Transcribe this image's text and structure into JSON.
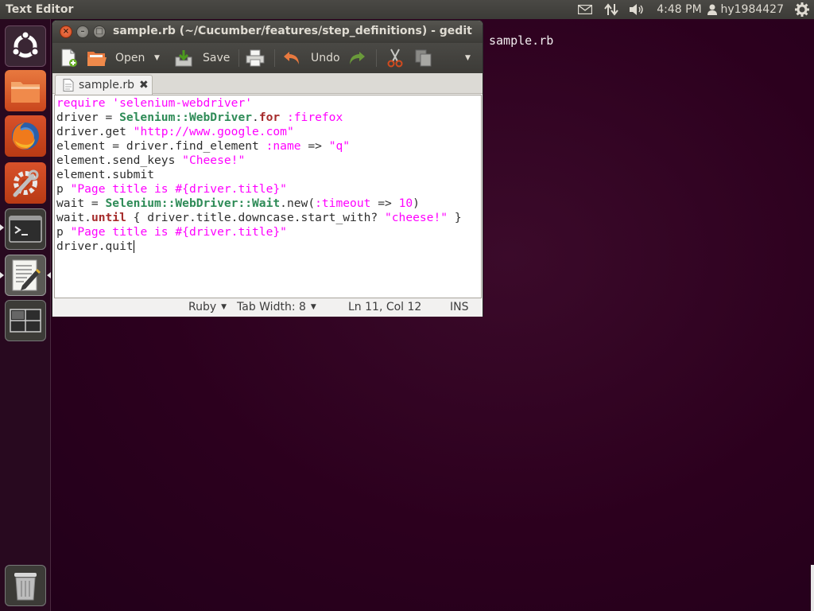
{
  "panel": {
    "app_title": "Text Editor",
    "clock": "4:48 PM",
    "user": "hy1984427",
    "icons": [
      "mail-icon",
      "network-icon",
      "volume-icon",
      "user-icon",
      "settings-gear-icon"
    ]
  },
  "launcher": {
    "items": [
      {
        "name": "ubuntu-dash-icon"
      },
      {
        "name": "files-icon"
      },
      {
        "name": "firefox-icon"
      },
      {
        "name": "system-settings-icon"
      },
      {
        "name": "terminal-icon"
      },
      {
        "name": "text-editor-icon"
      },
      {
        "name": "workspace-switcher-icon"
      },
      {
        "name": "trash-icon"
      }
    ]
  },
  "window": {
    "title": "sample.rb (~/Cucumber/features/step_definitions) - gedit"
  },
  "toolbar": {
    "open_label": "Open",
    "save_label": "Save",
    "undo_label": "Undo"
  },
  "tab": {
    "label": "sample.rb",
    "close_glyph": "✖"
  },
  "code": {
    "lines": [
      [
        {
          "t": "str",
          "v": "require 'selenium-webdriver'"
        }
      ],
      [
        {
          "t": "plain",
          "v": "driver = "
        },
        {
          "t": "const",
          "v": "Selenium::WebDriver"
        },
        {
          "t": "plain",
          "v": "."
        },
        {
          "t": "kw",
          "v": "for"
        },
        {
          "t": "plain",
          "v": " "
        },
        {
          "t": "sym",
          "v": ":firefox"
        }
      ],
      [
        {
          "t": "plain",
          "v": "driver.get "
        },
        {
          "t": "str",
          "v": "\"http://www.google.com\""
        }
      ],
      [
        {
          "t": "plain",
          "v": "element = driver.find_element "
        },
        {
          "t": "sym",
          "v": ":name"
        },
        {
          "t": "plain",
          "v": " => "
        },
        {
          "t": "str",
          "v": "\"q\""
        }
      ],
      [
        {
          "t": "plain",
          "v": "element.send_keys "
        },
        {
          "t": "str",
          "v": "\"Cheese!\""
        }
      ],
      [
        {
          "t": "plain",
          "v": "element.submit"
        }
      ],
      [
        {
          "t": "plain",
          "v": "p "
        },
        {
          "t": "str",
          "v": "\"Page title is #{driver.title}\""
        }
      ],
      [
        {
          "t": "plain",
          "v": "wait = "
        },
        {
          "t": "const",
          "v": "Selenium::WebDriver::Wait"
        },
        {
          "t": "plain",
          "v": ".new("
        },
        {
          "t": "sym",
          "v": ":timeout"
        },
        {
          "t": "plain",
          "v": " => "
        },
        {
          "t": "num",
          "v": "10"
        },
        {
          "t": "plain",
          "v": ")"
        }
      ],
      [
        {
          "t": "plain",
          "v": "wait."
        },
        {
          "t": "kw",
          "v": "until"
        },
        {
          "t": "plain",
          "v": " { driver.title.downcase.start_with? "
        },
        {
          "t": "str",
          "v": "\"cheese!\""
        },
        {
          "t": "plain",
          "v": " }"
        }
      ],
      [
        {
          "t": "plain",
          "v": "p "
        },
        {
          "t": "str",
          "v": "\"Page title is #{driver.title}\""
        }
      ],
      [
        {
          "t": "plain",
          "v": "driver.quit"
        }
      ]
    ]
  },
  "statusbar": {
    "language": "Ruby",
    "tab_width": "Tab Width:  8",
    "position": "Ln 11, Col 12",
    "mode": "INS"
  },
  "desktop": {
    "label": "sample.rb"
  },
  "colors": {
    "desktop_bg": "#2c001e",
    "panel_bg": "#3c3b37",
    "string": "#ff00ff",
    "keyword": "#a52a2a",
    "constant": "#2e8b57",
    "close_button": "#e05d2f"
  }
}
